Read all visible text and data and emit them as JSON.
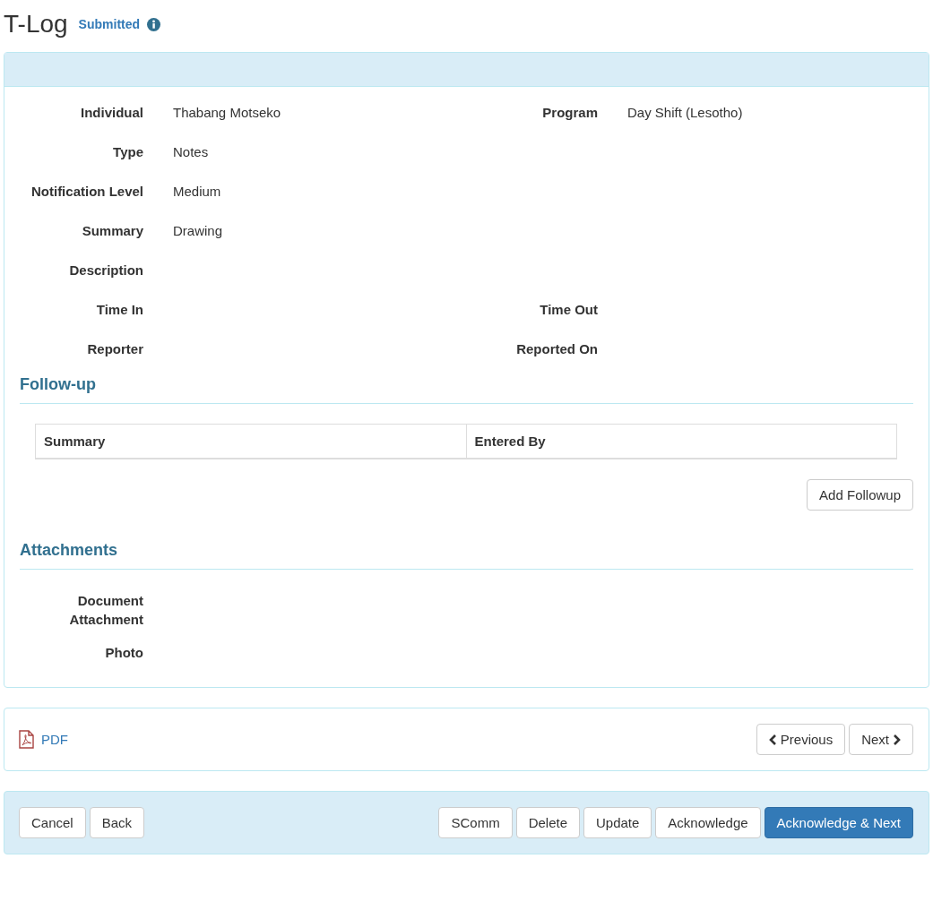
{
  "title": "T-Log",
  "status": "Submitted",
  "fields": [
    {
      "cells": [
        {
          "label": "Individual",
          "value": "Thabang Motseko"
        },
        {
          "label": "Program",
          "value": "Day Shift (Lesotho)"
        }
      ]
    },
    {
      "cells": [
        {
          "label": "Type",
          "value": "Notes"
        }
      ]
    },
    {
      "cells": [
        {
          "label": "Notification Level",
          "value": "Medium"
        }
      ]
    },
    {
      "cells": [
        {
          "label": "Summary",
          "value": "Drawing"
        }
      ]
    },
    {
      "cells": [
        {
          "label": "Description"
        }
      ]
    },
    {
      "cells": [
        {
          "label": "Time In"
        },
        {
          "label": "Time Out"
        }
      ]
    },
    {
      "cells": [
        {
          "label": "Reporter"
        },
        {
          "label": "Reported On"
        }
      ]
    }
  ],
  "followup": {
    "heading": "Follow-up",
    "columns": [
      "Summary",
      "Entered By"
    ],
    "button": "Add Followup"
  },
  "attachments": {
    "heading": "Attachments",
    "fields": [
      {
        "label": "Document Attachment"
      },
      {
        "label": "Photo"
      }
    ]
  },
  "pdf_link": "PDF",
  "nav": {
    "previous": "Previous",
    "next": "Next"
  },
  "footer": {
    "left": [
      "Cancel",
      "Back"
    ],
    "right": [
      {
        "label": "SComm",
        "primary": false
      },
      {
        "label": "Delete",
        "primary": false
      },
      {
        "label": "Update",
        "primary": false
      },
      {
        "label": "Acknowledge",
        "primary": false
      },
      {
        "label": "Acknowledge & Next",
        "primary": true
      }
    ]
  }
}
